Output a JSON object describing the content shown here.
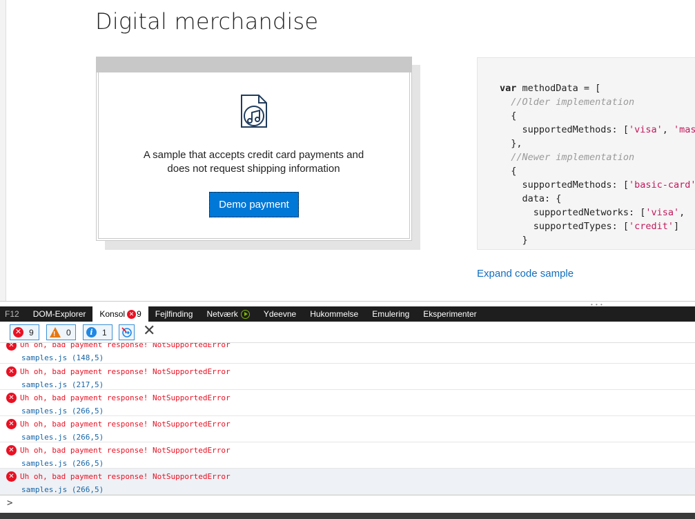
{
  "page": {
    "title": "Digital merchandise",
    "card": {
      "icon": "music-file-icon",
      "description_line1": "A sample that accepts credit card payments and",
      "description_line2": "does not request shipping information",
      "button_label": "Demo payment"
    },
    "code": {
      "lines": [
        {
          "pre": "",
          "kw": "var",
          "text": " methodData = [",
          "cls": ""
        },
        {
          "pre": "  ",
          "kw": "",
          "text": "//Older implementation",
          "cls": "cm"
        },
        {
          "pre": "  ",
          "kw": "",
          "text": "{",
          "cls": ""
        },
        {
          "pre": "    ",
          "kw": "",
          "text": "supportedMethods: [",
          "str": "'visa'",
          "after": ", ",
          "str2": "'mastercard'",
          "cls": ""
        },
        {
          "pre": "  ",
          "kw": "",
          "text": "},",
          "cls": ""
        },
        {
          "pre": "  ",
          "kw": "",
          "text": "//Newer implementation",
          "cls": "cm"
        },
        {
          "pre": "  ",
          "kw": "",
          "text": "{",
          "cls": ""
        },
        {
          "pre": "    ",
          "kw": "",
          "text": "supportedMethods: [",
          "str": "'basic-card'",
          "cls": ""
        },
        {
          "pre": "    ",
          "kw": "",
          "text": "data: {",
          "cls": ""
        },
        {
          "pre": "      ",
          "kw": "",
          "text": "supportedNetworks: [",
          "str": "'visa'",
          "after": ", ",
          "cls": ""
        },
        {
          "pre": "      ",
          "kw": "",
          "text": "supportedTypes: [",
          "str": "'credit'",
          "after": "]",
          "cls": ""
        },
        {
          "pre": "    ",
          "kw": "",
          "text": "}",
          "cls": ""
        }
      ]
    },
    "expand_link": "Expand code sample"
  },
  "devtools": {
    "tabs": [
      {
        "label": "F12",
        "name": "tab-f12"
      },
      {
        "label": "DOM-Explorer",
        "name": "tab-dom-explorer"
      },
      {
        "label": "Konsol",
        "name": "tab-konsol",
        "badge": "9",
        "active": true
      },
      {
        "label": "Fejlfinding",
        "name": "tab-fejlfinding"
      },
      {
        "label": "Netværk",
        "name": "tab-netvaerk",
        "play": true
      },
      {
        "label": "Ydeevne",
        "name": "tab-ydeevne"
      },
      {
        "label": "Hukommelse",
        "name": "tab-hukommelse"
      },
      {
        "label": "Emulering",
        "name": "tab-emulering"
      },
      {
        "label": "Eksperimenter",
        "name": "tab-eksperimenter"
      }
    ],
    "filters": {
      "errors": "9",
      "warnings": "0",
      "info": "1"
    },
    "log": [
      {
        "message": "Uh oh, bad payment response! NotSupportedError",
        "source": "samples.js (148,5)"
      },
      {
        "message": "Uh oh, bad payment response! NotSupportedError",
        "source": "samples.js (217,5)"
      },
      {
        "message": "Uh oh, bad payment response! NotSupportedError",
        "source": "samples.js (266,5)"
      },
      {
        "message": "Uh oh, bad payment response! NotSupportedError",
        "source": "samples.js (266,5)"
      },
      {
        "message": "Uh oh, bad payment response! NotSupportedError",
        "source": "samples.js (266,5)"
      },
      {
        "message": "Uh oh, bad payment response! NotSupportedError",
        "source": "samples.js (266,5)"
      }
    ],
    "prompt": ">"
  }
}
